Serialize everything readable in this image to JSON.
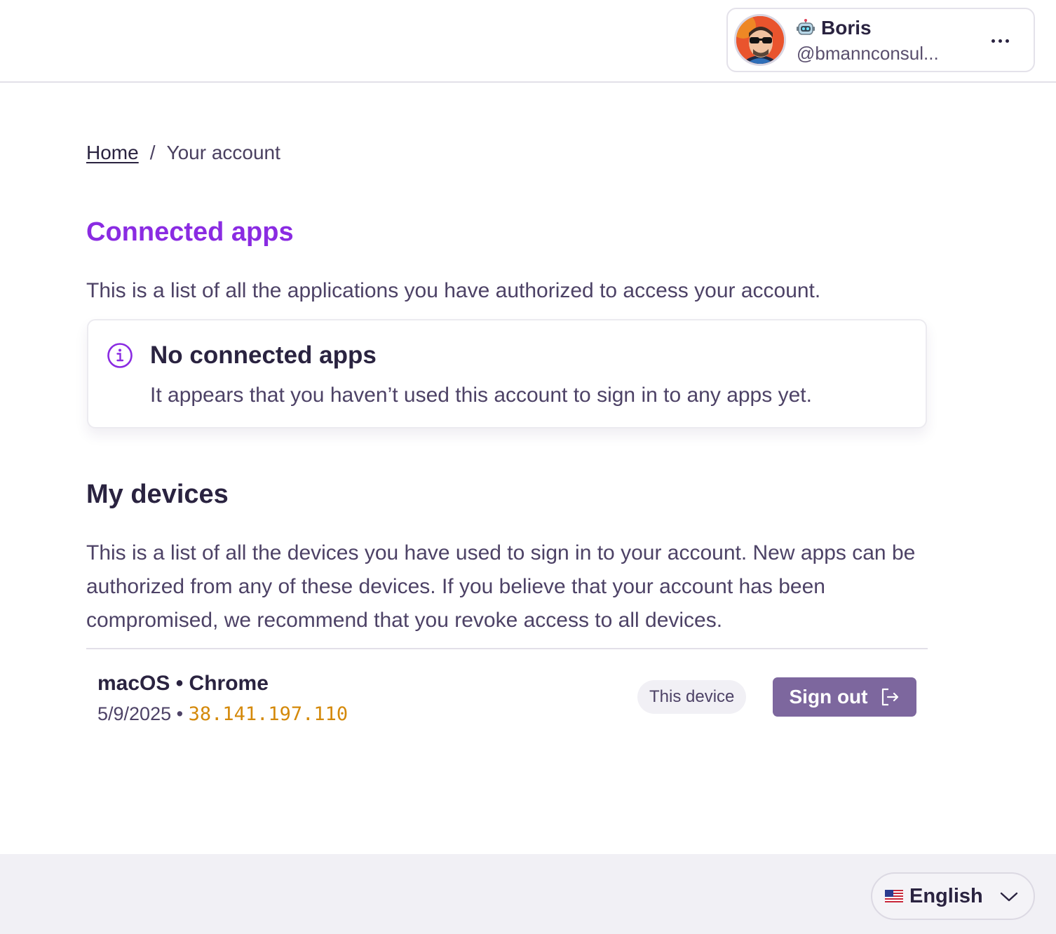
{
  "header": {
    "account": {
      "name": "Boris",
      "handle": "@bmannconsul...",
      "avatar_icon": "user-avatar",
      "name_icon": "robot-icon",
      "more_icon": "more-horizontal-icon"
    }
  },
  "breadcrumb": {
    "home": "Home",
    "separator": "/",
    "current": "Your account"
  },
  "connected_apps": {
    "title": "Connected apps",
    "description": "This is a list of all the applications you have authorized to access your account.",
    "notice": {
      "icon": "info-icon",
      "title": "No connected apps",
      "body": "It appears that you haven’t used this account to sign in to any apps yet."
    }
  },
  "devices": {
    "title": "My devices",
    "description": "This is a list of all the devices you have used to sign in to your account. New apps can be authorized from any of these devices. If you believe that your account has been compromised, we recommend that you revoke access to all devices.",
    "items": [
      {
        "name": "macOS • Chrome",
        "date": "5/9/2025",
        "separator": "•",
        "ip": "38.141.197.110",
        "badge": "This device",
        "action": "Sign out",
        "action_icon": "sign-out-icon"
      }
    ]
  },
  "footer": {
    "language": {
      "flag": "us-flag-icon",
      "label": "English",
      "chevron": "chevron-down-icon"
    }
  },
  "colors": {
    "accent": "#8a2be2",
    "button": "#7d679e",
    "ip": "#d4890a",
    "footer_bg": "#f1f0f5"
  }
}
